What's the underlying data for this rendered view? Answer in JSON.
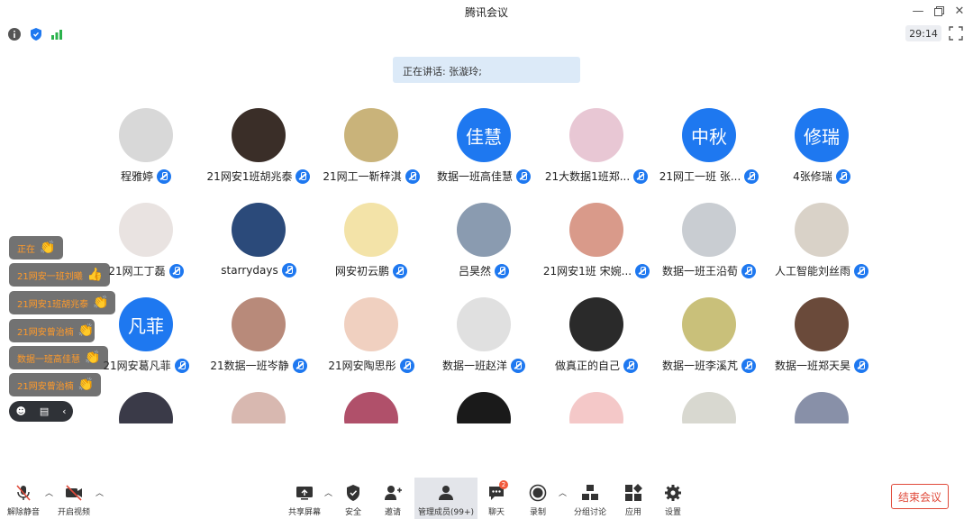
{
  "window": {
    "title": "腾讯会议"
  },
  "infobar": {
    "timer": "29:14"
  },
  "speaking": {
    "text": "正在讲话: 张漩玲;"
  },
  "participants": [
    {
      "name": "程雅婷",
      "avatar_text": "",
      "photo_color": "#d8d8d8"
    },
    {
      "name": "21网安1班胡兆泰",
      "avatar_text": "",
      "photo_color": "#3a2e28"
    },
    {
      "name": "21网工一靳梓淇",
      "avatar_text": "",
      "photo_color": "#c9b37a"
    },
    {
      "name": "数据一班高佳慧",
      "avatar_text": "佳慧",
      "photo_color": "#1e78f0"
    },
    {
      "name": "21大数据1班郑...",
      "avatar_text": "",
      "photo_color": "#e8c7d4"
    },
    {
      "name": "21网工一班 张...",
      "avatar_text": "中秋",
      "photo_color": "#1e78f0"
    },
    {
      "name": "4张修瑞",
      "avatar_text": "修瑞",
      "photo_color": "#1e78f0"
    },
    {
      "name": "21网工丁磊",
      "avatar_text": "",
      "photo_color": "#e9e3e1"
    },
    {
      "name": "starrydays",
      "avatar_text": "",
      "photo_color": "#2b4a7a"
    },
    {
      "name": "网安初云鹏",
      "avatar_text": "",
      "photo_color": "#f3e3a8"
    },
    {
      "name": "吕昊然",
      "avatar_text": "",
      "photo_color": "#8a9bb0"
    },
    {
      "name": "21网安1班  宋婉...",
      "avatar_text": "",
      "photo_color": "#d99a8a"
    },
    {
      "name": "数据一班王沿荀",
      "avatar_text": "",
      "photo_color": "#c9cdd2"
    },
    {
      "name": "人工智能刘丝雨",
      "avatar_text": "",
      "photo_color": "#d9d2c8"
    },
    {
      "name": "21网安葛凡菲",
      "avatar_text": "凡菲",
      "photo_color": "#1e78f0"
    },
    {
      "name": "21数据一班岑静",
      "avatar_text": "",
      "photo_color": "#b88a7a"
    },
    {
      "name": "21网安陶思彤",
      "avatar_text": "",
      "photo_color": "#f0d0c0"
    },
    {
      "name": "数据一班赵洋",
      "avatar_text": "",
      "photo_color": "#e0e0e0"
    },
    {
      "name": "做真正的自己",
      "avatar_text": "",
      "photo_color": "#2a2a2a"
    },
    {
      "name": "数据一班李溪芃",
      "avatar_text": "",
      "photo_color": "#c9c07a"
    },
    {
      "name": "数据一班郑天昊",
      "avatar_text": "",
      "photo_color": "#6a4a3a"
    }
  ],
  "partial_row": [
    "#3a3a48",
    "#d8b8b0",
    "#b0506a",
    "#1a1a1a",
    "#f4c8c8",
    "#d8d8d0",
    "#8890a8"
  ],
  "reactions": [
    {
      "text": "正在"
    },
    {
      "text": "21网安一班刘曦"
    },
    {
      "text": "21网安1班胡兆泰"
    },
    {
      "text": "21网安曾治楠"
    },
    {
      "text": "数据一班高佳慧"
    },
    {
      "text": "21网安曾治楠"
    }
  ],
  "toolbar": {
    "mute": "解除静音",
    "video": "开启视频",
    "share": "共享屏幕",
    "security": "安全",
    "invite": "邀请",
    "members": "管理成员(99+)",
    "chat": "聊天",
    "chat_badge": "2",
    "record": "录制",
    "breakout": "分组讨论",
    "apps": "应用",
    "settings": "设置",
    "end": "结束会议"
  },
  "colors": {
    "accent": "#1e78f0",
    "end": "#e04a3a",
    "reaction_text": "#ff9a2a"
  }
}
